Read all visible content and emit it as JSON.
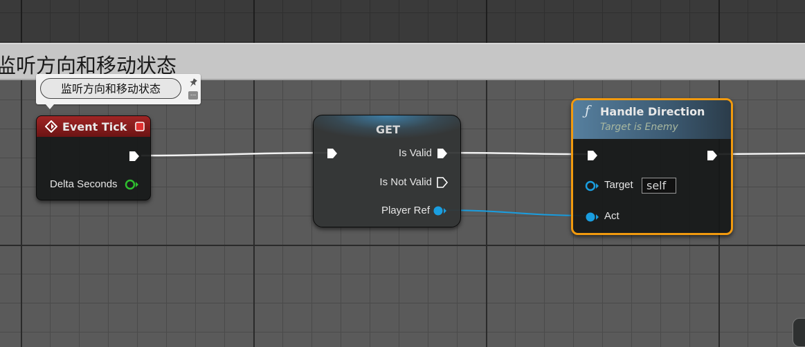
{
  "comment": {
    "title": "监听方向和移动状态",
    "bubble_text": "监听方向和移动状态",
    "pin_icon": "pin-icon",
    "more_icon": "ellipsis-icon"
  },
  "nodes": {
    "event_tick": {
      "title": "Event Tick",
      "icon": "event-diamond-icon",
      "pins": {
        "delta_seconds": "Delta Seconds"
      }
    },
    "get": {
      "title": "GET",
      "pins": {
        "is_valid": "Is Valid",
        "is_not_valid": "Is Not Valid",
        "player_ref": "Player Ref"
      }
    },
    "handle_direction": {
      "title": "Handle Direction",
      "subtitle": "Target is Enemy",
      "icon_glyph": "ƒ",
      "pins": {
        "target": "Target",
        "target_value": "self",
        "act": "Act"
      }
    }
  },
  "colors": {
    "exec_wire": "#ffffff",
    "object_wire": "#1a9ee0",
    "float_pin": "#2fbf2f",
    "event_header": "#a12525",
    "function_header": "#567f9e",
    "selection_outline": "#f29a0e"
  }
}
